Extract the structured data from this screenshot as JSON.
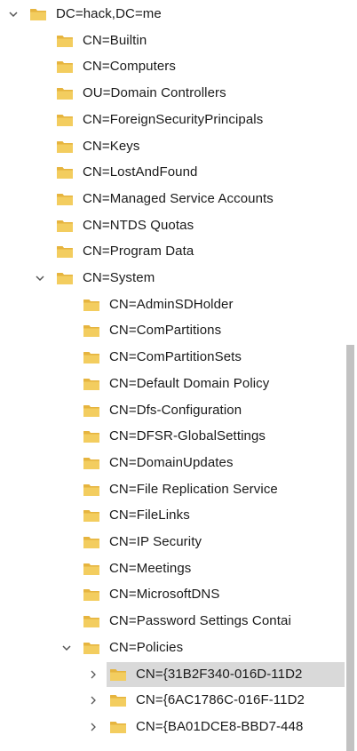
{
  "tree": {
    "items": [
      {
        "label": "DC=hack,DC=me",
        "level": 0,
        "toggle": "expanded"
      },
      {
        "label": "CN=Builtin",
        "level": 1,
        "toggle": "none"
      },
      {
        "label": "CN=Computers",
        "level": 1,
        "toggle": "none"
      },
      {
        "label": "OU=Domain Controllers",
        "level": 1,
        "toggle": "none"
      },
      {
        "label": "CN=ForeignSecurityPrincipals",
        "level": 1,
        "toggle": "none"
      },
      {
        "label": "CN=Keys",
        "level": 1,
        "toggle": "none"
      },
      {
        "label": "CN=LostAndFound",
        "level": 1,
        "toggle": "none"
      },
      {
        "label": "CN=Managed Service Accounts",
        "level": 1,
        "toggle": "none"
      },
      {
        "label": "CN=NTDS Quotas",
        "level": 1,
        "toggle": "none"
      },
      {
        "label": "CN=Program Data",
        "level": 1,
        "toggle": "none"
      },
      {
        "label": "CN=System",
        "level": 1,
        "toggle": "expanded"
      },
      {
        "label": "CN=AdminSDHolder",
        "level": 2,
        "toggle": "none"
      },
      {
        "label": "CN=ComPartitions",
        "level": 2,
        "toggle": "none"
      },
      {
        "label": "CN=ComPartitionSets",
        "level": 2,
        "toggle": "none"
      },
      {
        "label": "CN=Default Domain Policy",
        "level": 2,
        "toggle": "none"
      },
      {
        "label": "CN=Dfs-Configuration",
        "level": 2,
        "toggle": "none"
      },
      {
        "label": "CN=DFSR-GlobalSettings",
        "level": 2,
        "toggle": "none"
      },
      {
        "label": "CN=DomainUpdates",
        "level": 2,
        "toggle": "none"
      },
      {
        "label": "CN=File Replication Service",
        "level": 2,
        "toggle": "none"
      },
      {
        "label": "CN=FileLinks",
        "level": 2,
        "toggle": "none"
      },
      {
        "label": "CN=IP Security",
        "level": 2,
        "toggle": "none"
      },
      {
        "label": "CN=Meetings",
        "level": 2,
        "toggle": "none"
      },
      {
        "label": "CN=MicrosoftDNS",
        "level": 2,
        "toggle": "none"
      },
      {
        "label": "CN=Password Settings Contai",
        "level": 2,
        "toggle": "none"
      },
      {
        "label": "CN=Policies",
        "level": 2,
        "toggle": "expanded"
      },
      {
        "label": "CN={31B2F340-016D-11D2",
        "level": 3,
        "toggle": "collapsed",
        "selected": true
      },
      {
        "label": "CN={6AC1786C-016F-11D2",
        "level": 3,
        "toggle": "collapsed"
      },
      {
        "label": "CN={BA01DCE8-BBD7-448",
        "level": 3,
        "toggle": "collapsed"
      }
    ]
  },
  "colors": {
    "folder_body": "#f3cd5f",
    "folder_tab": "#e6b43e",
    "selection": "#d9d9d9",
    "scroll_thumb": "#c2c2c2",
    "chevron": "#555555"
  }
}
